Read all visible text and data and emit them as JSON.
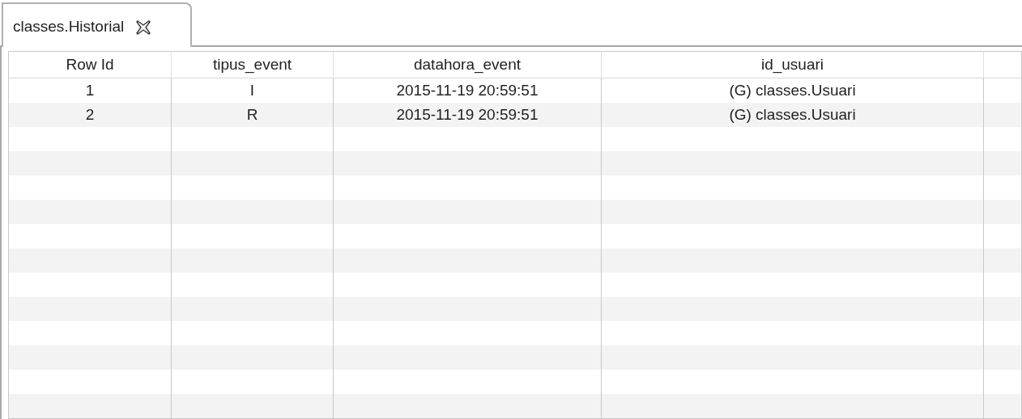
{
  "tabs": [
    {
      "label": "classes.Historial",
      "selected": true
    }
  ],
  "table": {
    "columns": [
      "Row Id",
      "tipus_event",
      "datahora_event",
      "id_usuari"
    ],
    "rows": [
      [
        "1",
        "I",
        "2015-11-19 20:59:51",
        "(G) classes.Usuari"
      ],
      [
        "2",
        "R",
        "2015-11-19 20:59:51",
        "(G) classes.Usuari"
      ]
    ]
  }
}
